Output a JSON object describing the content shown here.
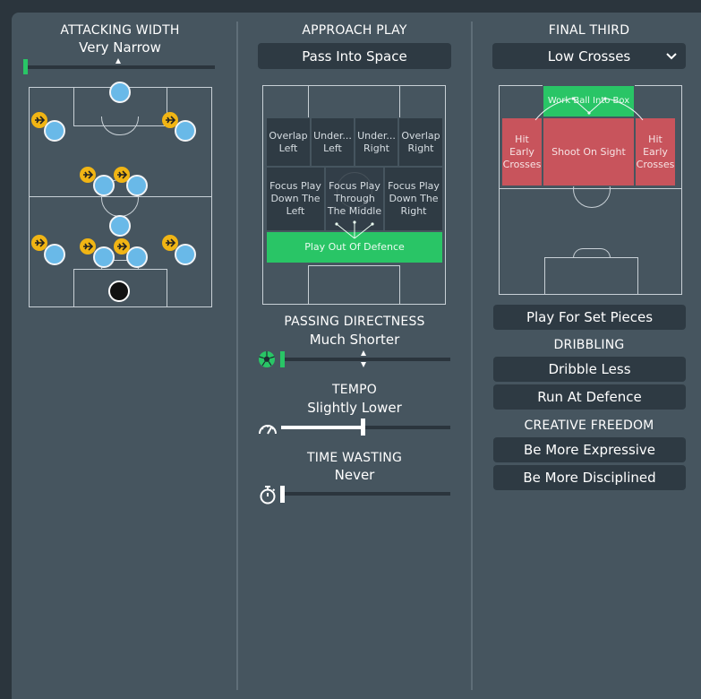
{
  "attacking_width": {
    "title": "ATTACKING WIDTH",
    "value": "Very Narrow",
    "level": 0.01
  },
  "approach_play": {
    "title": "APPROACH PLAY",
    "selected": "Pass Into Space",
    "zones": {
      "overlap_left": "Overlap Left",
      "underlap_left": "Under... Left",
      "underlap_right": "Under... Right",
      "overlap_right": "Overlap Right",
      "focus_left": "Focus Play Down The Left",
      "focus_middle": "Focus Play Through The Middle",
      "focus_right": "Focus Play Down The Right",
      "play_out": "Play Out Of Defence"
    }
  },
  "passing_directness": {
    "title": "PASSING DIRECTNESS",
    "value": "Much Shorter",
    "level": 0.01,
    "icon": "football-icon"
  },
  "tempo": {
    "title": "TEMPO",
    "value": "Slightly Lower",
    "level": 0.42,
    "icon": "speedometer-icon"
  },
  "time_wasting": {
    "title": "TIME WASTING",
    "value": "Never",
    "level": 0.0,
    "icon": "stopwatch-icon"
  },
  "final_third": {
    "title": "FINAL THIRD",
    "selected": "Low Crosses",
    "zones": {
      "work_ball": "Work Ball Into Box",
      "hit_early_left": "Hit Early Crosses",
      "shoot_on_sight": "Shoot On Sight",
      "hit_early_right": "Hit Early Crosses"
    },
    "set_pieces": "Play For Set Pieces"
  },
  "dribbling": {
    "title": "DRIBBLING",
    "options": [
      "Dribble Less",
      "Run At Defence"
    ]
  },
  "creative_freedom": {
    "title": "CREATIVE FREEDOM",
    "options": [
      "Be More Expressive",
      "Be More Disciplined"
    ]
  },
  "colors": {
    "accent_green": "#29c566",
    "zone_red": "#c8545c",
    "player_blue": "#69b9e8",
    "badge_yellow": "#f1b514"
  }
}
